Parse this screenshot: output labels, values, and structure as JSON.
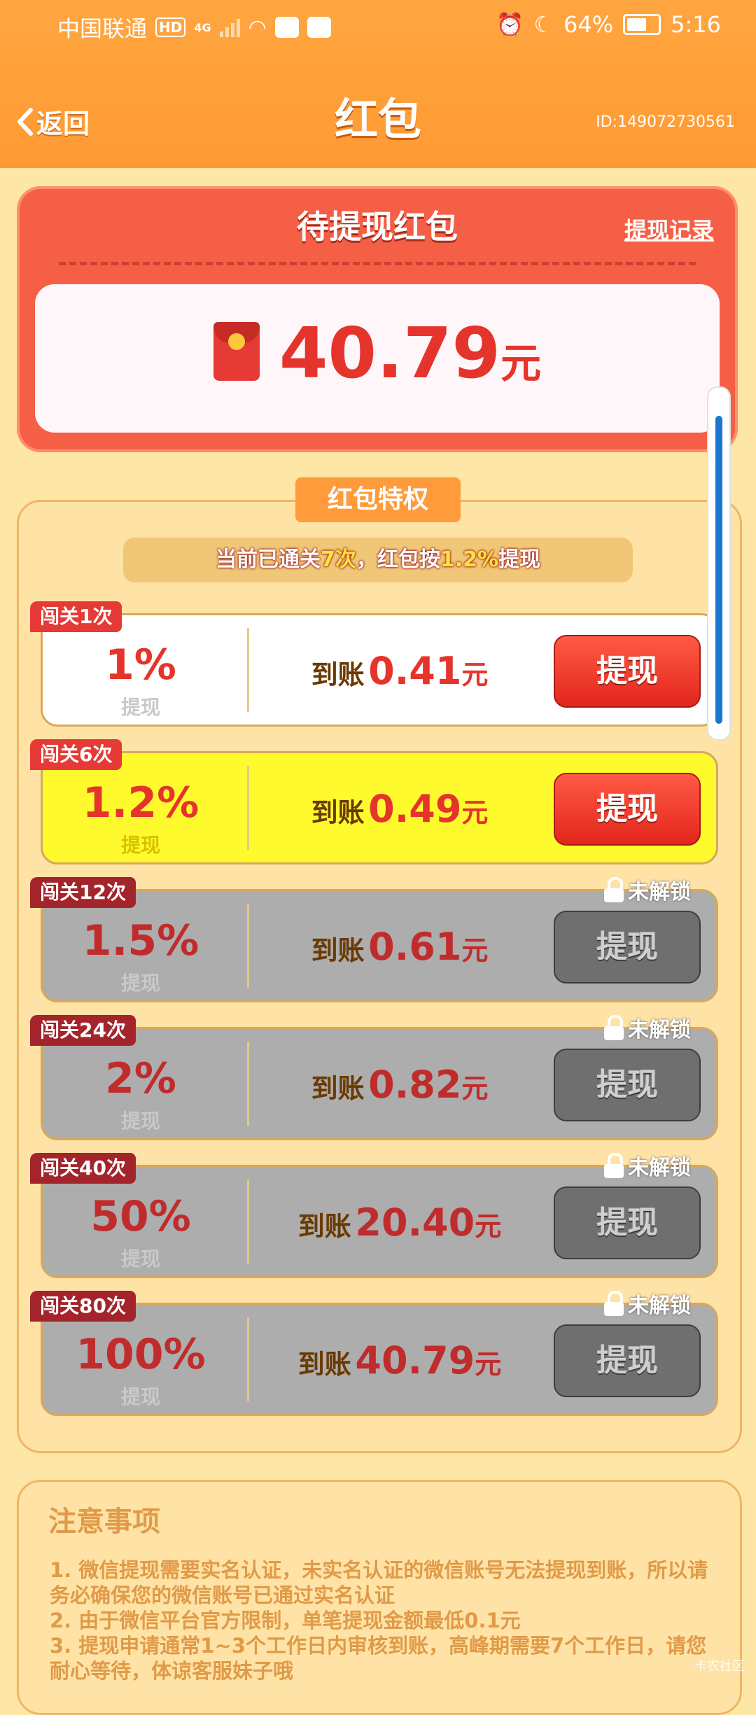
{
  "status_bar": {
    "carrier": "中国联通",
    "hd": "HD",
    "network": "4G",
    "battery": "64%",
    "time": "5:16"
  },
  "header": {
    "back_label": "返回",
    "title": "红包",
    "user_id": "ID:149072730561"
  },
  "pending": {
    "title": "待提现红包",
    "record_link": "提现记录",
    "amount": "40.79",
    "unit": "元"
  },
  "privilege": {
    "tab_label": "红包特权",
    "note_prefix": "当前已通关",
    "note_count": "7次",
    "note_middle": "，红包按",
    "note_rate": "1.2%",
    "note_suffix": "提现",
    "arrive_label": "到账",
    "currency": "元",
    "withdraw_sub": "提现",
    "locked_label": "未解锁",
    "tiers": [
      {
        "tag": "闯关1次",
        "percent": "1%",
        "amount": "0.41",
        "button": "提现",
        "status": "available"
      },
      {
        "tag": "闯关6次",
        "percent": "1.2%",
        "amount": "0.49",
        "button": "提现",
        "status": "current"
      },
      {
        "tag": "闯关12次",
        "percent": "1.5%",
        "amount": "0.61",
        "button": "提现",
        "status": "locked"
      },
      {
        "tag": "闯关24次",
        "percent": "2%",
        "amount": "0.82",
        "button": "提现",
        "status": "locked"
      },
      {
        "tag": "闯关40次",
        "percent": "50%",
        "amount": "20.40",
        "button": "提现",
        "status": "locked"
      },
      {
        "tag": "闯关80次",
        "percent": "100%",
        "amount": "40.79",
        "button": "提现",
        "status": "locked"
      }
    ]
  },
  "notes": {
    "title": "注意事项",
    "lines": [
      "1. 微信提现需要实名认证，未实名认证的微信账号无法提现到账，所以请务必确保您的微信账号已通过实名认证",
      "2. 由于微信平台官方限制，单笔提现金额最低0.1元",
      "3. 提现申请通常1~3个工作日内审核到账，高峰期需要7个工作日，请您耐心等待，体谅客服妹子哦"
    ]
  },
  "watermark": "卡农社区",
  "colors": {
    "header": "#ff9a33",
    "pending_card": "#f55f46",
    "accent_red": "#e5342b",
    "current_row": "#fffa2e",
    "locked_row": "#adadad",
    "page_bg": "#fde6a6",
    "scroll_thumb": "#1976d2"
  }
}
